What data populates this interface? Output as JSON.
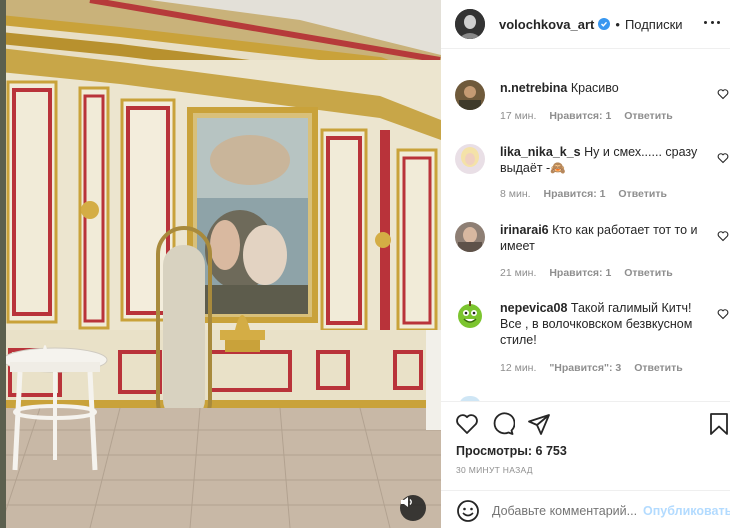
{
  "header": {
    "username": "volochkova_art",
    "separator": "•",
    "follow_label": "Подписки"
  },
  "comments": [
    {
      "username": "n.netrebina",
      "text": "Красиво",
      "time": "17 мин.",
      "likes": "Нравится: 1",
      "reply": "Ответить"
    },
    {
      "username": "lika_nika_k_s",
      "text": "Ну и смех...... сразу выдаёт -🙈",
      "time": "8 мин.",
      "likes": "Нравится: 1",
      "reply": "Ответить"
    },
    {
      "username": "irinarai6",
      "text": "Кто как работает тот то и имеет",
      "time": "21 мин.",
      "likes": "Нравится: 1",
      "reply": "Ответить"
    },
    {
      "username": "nepevica08",
      "text": "Такой галимый Китч! Все , в волочковском безвкусном стиле!",
      "time": "12 мин.",
      "likes": "\"Нравится\": 3",
      "reply": "Ответить"
    }
  ],
  "stats": {
    "views": "Просмотры: 6 753",
    "time_ago": "30 МИНУТ НАЗАД"
  },
  "comment_bar": {
    "placeholder": "Добавьте комментарий...",
    "publish_label": "Опубликовать"
  },
  "colors": {
    "accent": "#3897f0",
    "publish_disabled": "#b3dbff",
    "muted_text": "#8e8e8e"
  },
  "icons": [
    "sound-icon",
    "verified-icon",
    "more-icon",
    "heart-icon",
    "comment-icon",
    "share-icon",
    "bookmark-icon",
    "emoji-icon"
  ]
}
